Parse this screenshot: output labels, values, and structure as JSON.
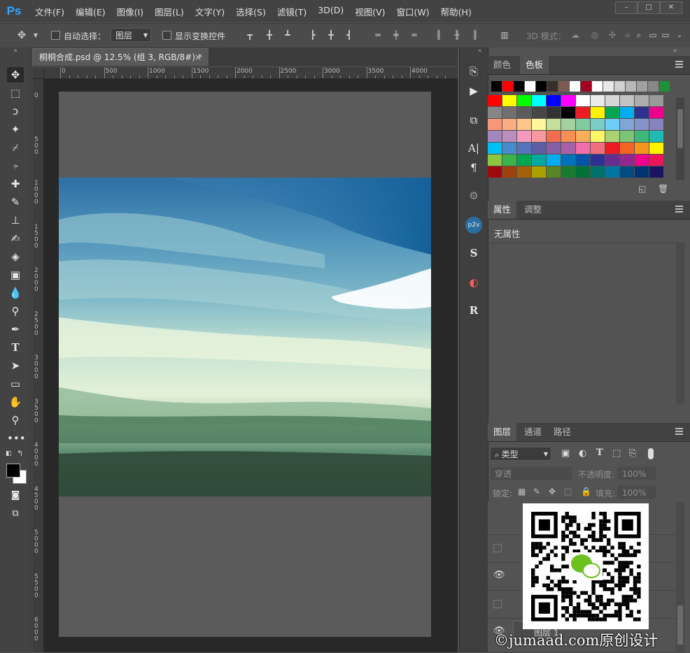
{
  "app": {
    "logo": "Ps"
  },
  "menu": [
    "文件(F)",
    "编辑(E)",
    "图像(I)",
    "图层(L)",
    "文字(Y)",
    "选择(S)",
    "滤镜(T)",
    "3D(D)",
    "视图(V)",
    "窗口(W)",
    "帮助(H)"
  ],
  "window_controls": {
    "minimize": "–",
    "maximize": "□",
    "close": "✕"
  },
  "options": {
    "auto_select_label": "自动选择：",
    "auto_select_value": "图层",
    "show_transform_label": "显示变换控件",
    "mode_3d_label": "3D 模式："
  },
  "document": {
    "tab_title": "桐桐合成.psd @ 12.5% (组 3, RGB/8#) *",
    "tab_close": "×",
    "ruler_top": [
      "0",
      "500",
      "1000",
      "1500",
      "2000",
      "2500",
      "3000",
      "3500",
      "4000"
    ],
    "ruler_left": [
      "0",
      "5\n0\n0",
      "1\n0\n0\n0",
      "1\n5\n0\n0",
      "2\n0\n0\n0",
      "2\n5\n0\n0",
      "3\n0\n0\n0",
      "3\n5\n0\n0",
      "4\n0\n0\n0",
      "4\n5\n0\n0",
      "5\n0\n0\n0",
      "5\n5\n0\n0",
      "6\n0\n0\n0"
    ]
  },
  "color_panel": {
    "tabs": [
      "颜色",
      "色板"
    ],
    "active_tab": "色板",
    "recent_colors": [
      "#000000",
      "#ff0000",
      "#000000",
      "#ffffff",
      "#000000",
      "#3a2e2a",
      "#7b5a52",
      "#ffffff",
      "#a50021",
      "#ffffff",
      "#e8e8e8",
      "#d0d0d0",
      "#b8b8b8",
      "#a0a0a0",
      "#888888",
      "#1f8f3a"
    ],
    "swatches": [
      [
        "#ff0000",
        "#ffff00",
        "#00ff00",
        "#00ffff",
        "#0000ff",
        "#ff00ff",
        "#ffffff",
        "#ebebeb",
        "#d6d6d6",
        "#c2c2c2",
        "#adadad",
        "#999999"
      ],
      [
        "#858585",
        "#707070",
        "#5c5c5c",
        "#474747",
        "#333333",
        "#000000",
        "#ec1c24",
        "#fff200",
        "#00a651",
        "#00aeef",
        "#2e3192",
        "#ec008c"
      ],
      [
        "#f7977a",
        "#f9ad81",
        "#fdc68a",
        "#fff79a",
        "#c4df9b",
        "#a3d39c",
        "#82ca9d",
        "#7bcdc8",
        "#6ecff6",
        "#7ea7d8",
        "#8493ca",
        "#8882be"
      ],
      [
        "#a187be",
        "#bc8dbf",
        "#f49ac2",
        "#f6989d",
        "#f26c4f",
        "#f68e56",
        "#fbaf5d",
        "#fff568",
        "#acd373",
        "#7cc576",
        "#3cb878",
        "#1cbbb4"
      ],
      [
        "#00bff3",
        "#448ccb",
        "#5674b9",
        "#605ca8",
        "#855fa8",
        "#a863a8",
        "#f06eaa",
        "#f26d7d",
        "#ed1c24",
        "#f26522",
        "#f7941d",
        "#fff200"
      ],
      [
        "#8dc63f",
        "#39b54a",
        "#00a651",
        "#00a99d",
        "#00aeef",
        "#0072bc",
        "#0054a6",
        "#2e3192",
        "#662d91",
        "#92278f",
        "#ec008c",
        "#ed145b"
      ],
      [
        "#9e0b0f",
        "#a0410d",
        "#a36209",
        "#aba000",
        "#598527",
        "#197b30",
        "#007236",
        "#00746b",
        "#0076a3",
        "#004b80",
        "#003471",
        "#1b1464"
      ]
    ]
  },
  "properties_panel": {
    "tabs": [
      "属性",
      "调整"
    ],
    "active_tab": "属性",
    "empty_text": "无属性"
  },
  "layers_panel": {
    "tabs": [
      "图层",
      "通道",
      "路径"
    ],
    "active_tab": "图层",
    "filter_label": "类型",
    "blend_mode": "穿透",
    "opacity_label": "不透明度:",
    "opacity_value": "100%",
    "lock_label": "锁定:",
    "fill_label": "填充:",
    "fill_value": "100%",
    "partial_layer_name": "图层 1"
  },
  "watermark": {
    "text": "©jumaad.com原创设计"
  }
}
